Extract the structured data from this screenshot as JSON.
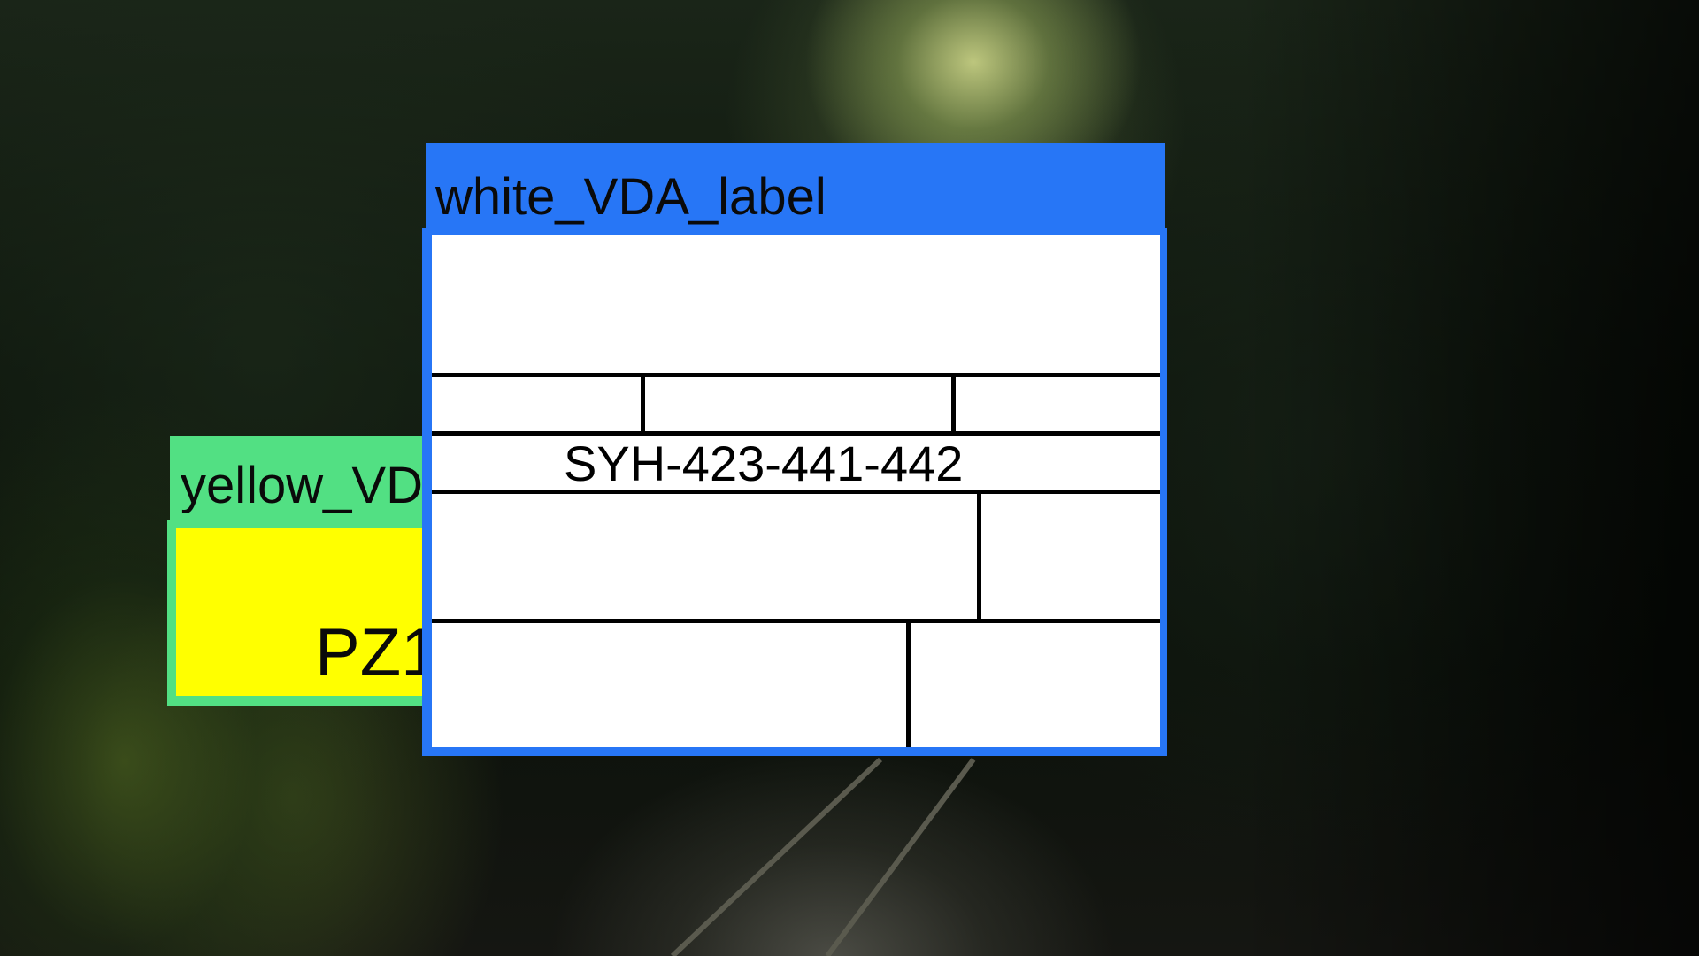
{
  "yellow_label": {
    "title": "yellow_VD",
    "code": "PZ1",
    "frame_color": "#52e083",
    "fill_color": "#ffff00"
  },
  "white_label": {
    "title": "white_VDA_label",
    "code": "SYH-423-441-442",
    "frame_color": "#2776f6",
    "fill_color": "#ffffff"
  }
}
